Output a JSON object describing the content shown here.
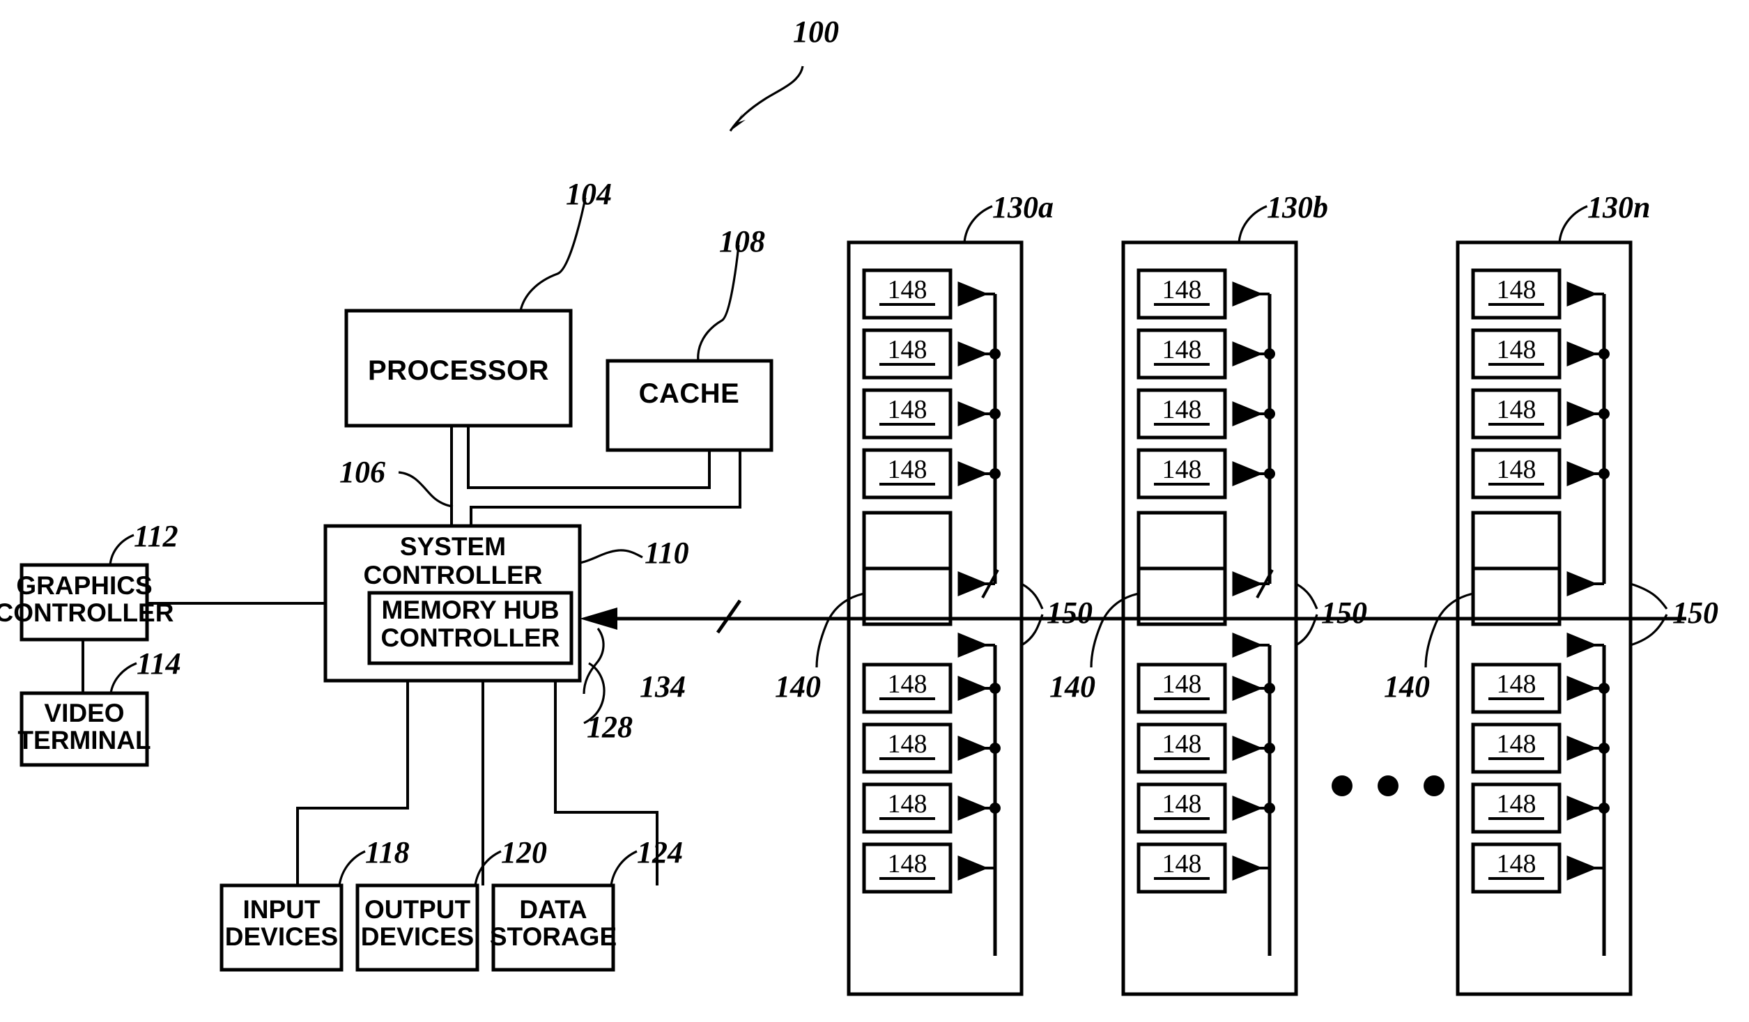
{
  "figure": {
    "title_ref": "100",
    "kind": "patent-block-diagram"
  },
  "blocks": {
    "processor": {
      "label": "PROCESSOR",
      "ref": "104"
    },
    "cache": {
      "label": "CACHE",
      "ref": "108"
    },
    "system_controller": {
      "label_line1": "SYSTEM",
      "label_line2": "CONTROLLER",
      "ref": "110"
    },
    "memory_hub_controller": {
      "label_line1": "MEMORY  HUB",
      "label_line2": "CONTROLLER",
      "ref": "128"
    },
    "graphics_controller": {
      "label_line1": "GRAPHICS",
      "label_line2": "CONTROLLER",
      "ref": "112"
    },
    "video_terminal": {
      "label_line1": "VIDEO",
      "label_line2": "TERMINAL",
      "ref": "114"
    },
    "input_devices": {
      "label_line1": "INPUT",
      "label_line2": "DEVICES",
      "ref": "118"
    },
    "output_devices": {
      "label_line1": "OUTPUT",
      "label_line2": "DEVICES",
      "ref": "120"
    },
    "data_storage": {
      "label_line1": "DATA",
      "label_line2": "STORAGE",
      "ref": "124"
    }
  },
  "buses": {
    "processor_bus_ref": "106",
    "system_bus_ref": "134",
    "memory_bus_ref": "150"
  },
  "memory_modules": [
    {
      "ref": "130a",
      "hub_ref": "140",
      "bus_ref": "150",
      "devices_top": [
        "148",
        "148",
        "148",
        "148"
      ],
      "devices_bottom": [
        "148",
        "148",
        "148",
        "148"
      ]
    },
    {
      "ref": "130b",
      "hub_ref": "140",
      "bus_ref": "150",
      "devices_top": [
        "148",
        "148",
        "148",
        "148"
      ],
      "devices_bottom": [
        "148",
        "148",
        "148",
        "148"
      ]
    },
    {
      "ref": "130n",
      "hub_ref": "140",
      "bus_ref": "150",
      "devices_top": [
        "148",
        "148",
        "148",
        "148"
      ],
      "devices_bottom": [
        "148",
        "148",
        "148",
        "148"
      ]
    }
  ],
  "ellipsis": "• • •",
  "colors": {
    "ink": "#000000",
    "paper": "#ffffff"
  }
}
